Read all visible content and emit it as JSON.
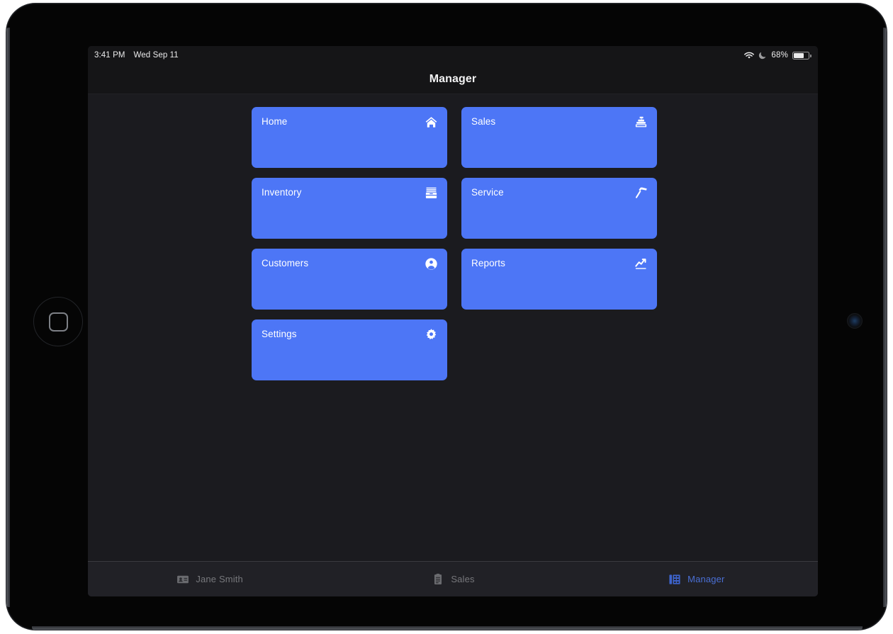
{
  "device": {
    "home_button_icon": "home-button-icon",
    "camera_icon": "front-camera-icon"
  },
  "status_bar": {
    "time": "3:41 PM",
    "date": "Wed Sep 11",
    "wifi_icon": "wifi-icon",
    "dnd_icon": "crescent-moon-icon",
    "battery_percent": "68%",
    "battery_icon": "battery-icon",
    "battery_level": 68
  },
  "header": {
    "title": "Manager"
  },
  "tiles": [
    {
      "label": "Home",
      "icon": "house-icon",
      "color": "#4d76f6"
    },
    {
      "label": "Sales",
      "icon": "cash-register-icon",
      "color": "#4d76f6"
    },
    {
      "label": "Inventory",
      "icon": "archive-box-icon",
      "color": "#4d76f6"
    },
    {
      "label": "Service",
      "icon": "hammer-icon",
      "color": "#4d76f6"
    },
    {
      "label": "Customers",
      "icon": "person-circle-icon",
      "color": "#4d76f6"
    },
    {
      "label": "Reports",
      "icon": "trending-up-icon",
      "color": "#4d76f6"
    },
    {
      "label": "Settings",
      "icon": "gear-icon",
      "color": "#4d76f6"
    }
  ],
  "tab_bar": [
    {
      "label": "Jane Smith",
      "icon": "contact-card-icon",
      "active": false
    },
    {
      "label": "Sales",
      "icon": "clipboard-icon",
      "active": false
    },
    {
      "label": "Manager",
      "icon": "dashboard-icon",
      "active": true
    }
  ],
  "colors": {
    "tile_blue": "#4d76f6",
    "active_tab_blue": "#4a6fd4",
    "screen_background": "#1b1b1f",
    "chrome_background": "#151517",
    "tab_bar_background": "#212126",
    "inactive_tab_gray": "#77787c"
  }
}
